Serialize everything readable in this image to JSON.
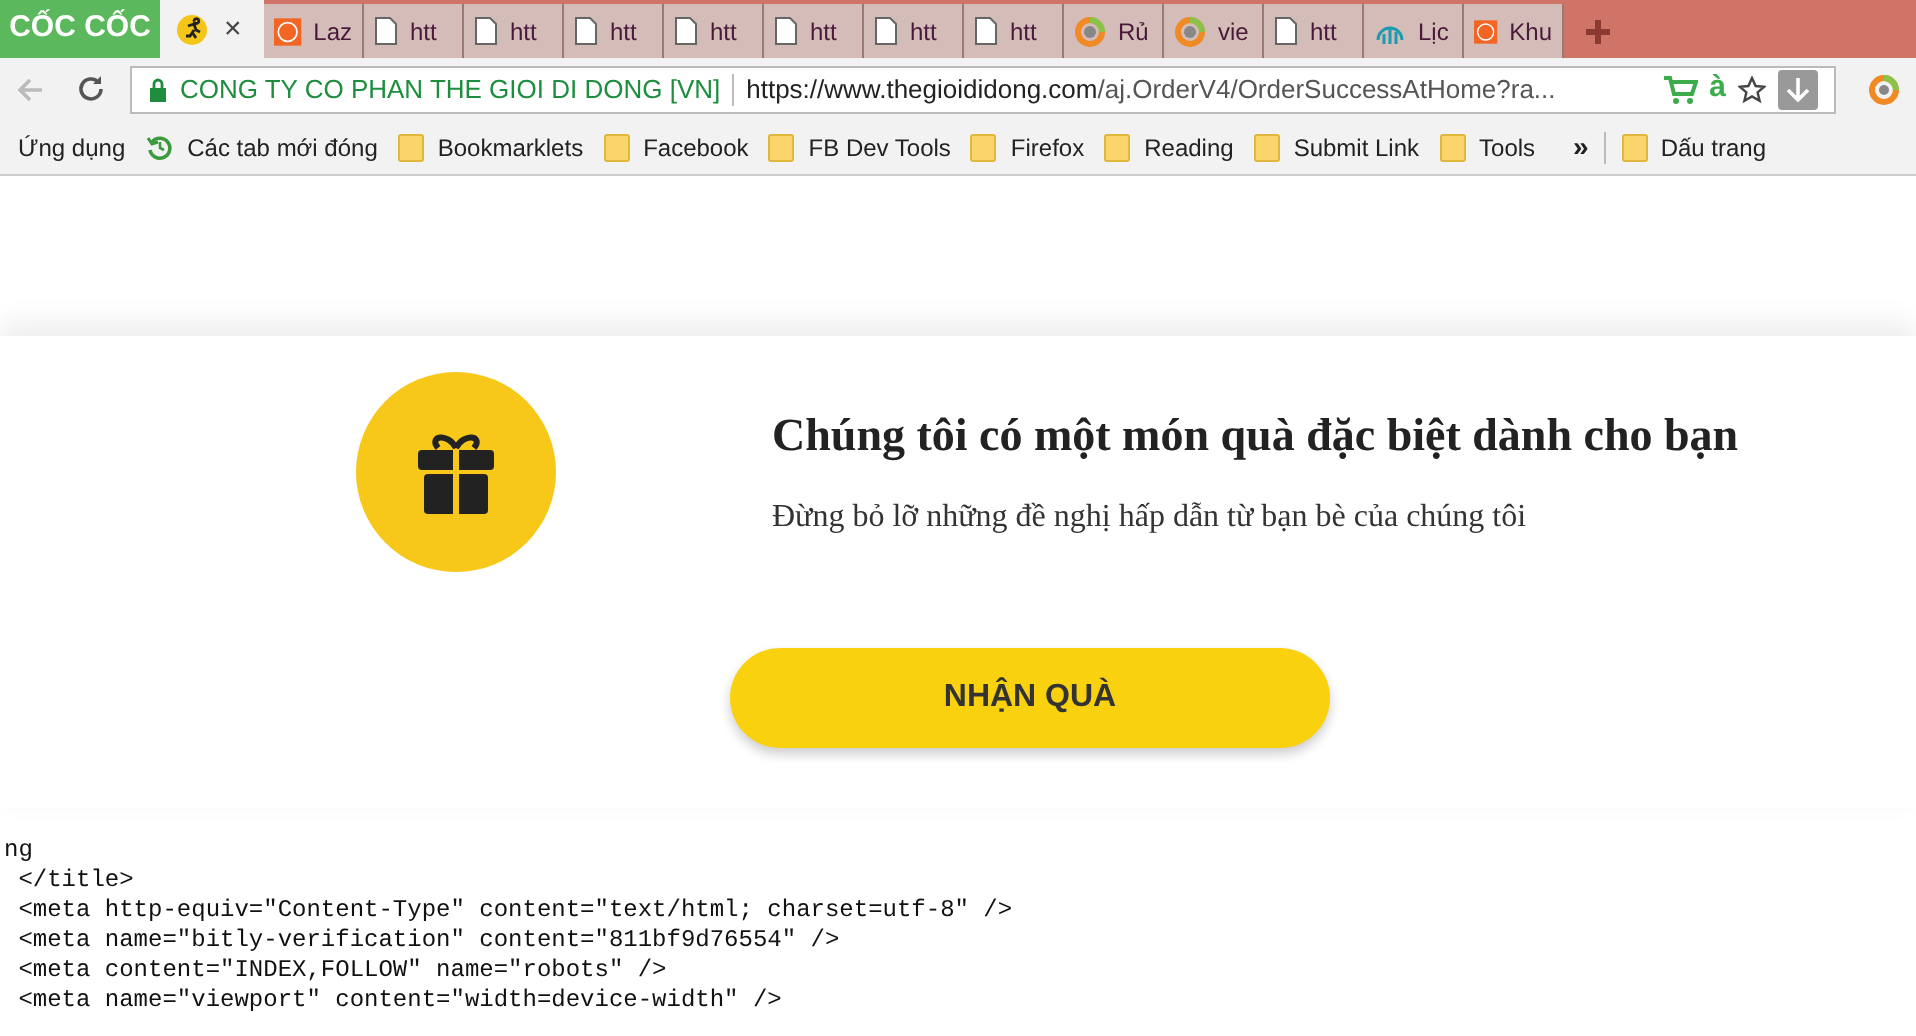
{
  "browser": {
    "logo": "CỐC CỐC",
    "tabs": [
      {
        "kind": "runner",
        "selected": true
      },
      {
        "title": "Laz",
        "kind": "orange",
        "selected": false
      },
      {
        "title": "htt",
        "kind": "page",
        "selected": false
      },
      {
        "title": "htt",
        "kind": "page",
        "selected": false
      },
      {
        "title": "htt",
        "kind": "page",
        "selected": false
      },
      {
        "title": "htt",
        "kind": "page",
        "selected": false
      },
      {
        "title": "htt",
        "kind": "page",
        "selected": false
      },
      {
        "title": "htt",
        "kind": "page",
        "selected": false
      },
      {
        "title": "htt",
        "kind": "page",
        "selected": false
      },
      {
        "title": "Rủ",
        "kind": "ring",
        "selected": false
      },
      {
        "title": "vie",
        "kind": "ring",
        "selected": false
      },
      {
        "title": "htt",
        "kind": "page",
        "selected": false
      },
      {
        "title": "Lịc",
        "kind": "chart",
        "selected": false
      },
      {
        "title": "Khu",
        "kind": "orange",
        "selected": false
      }
    ],
    "close": "×",
    "address": {
      "site": "CONG TY CO PHAN THE GIOI DI DONG [VN]",
      "host": "https://www.thegioididong.com",
      "path": "/aj.OrderV4/OrderSuccessAtHome?ra..."
    },
    "translate": "à",
    "bookmarks": [
      {
        "label": "Ứng dụng",
        "kind": "apps"
      },
      {
        "label": "Các tab mới đóng",
        "kind": "history"
      },
      {
        "label": "Bookmarklets",
        "kind": "folder"
      },
      {
        "label": "Facebook",
        "kind": "folder"
      },
      {
        "label": "FB Dev Tools",
        "kind": "folder"
      },
      {
        "label": "Firefox",
        "kind": "folder"
      },
      {
        "label": "Reading",
        "kind": "folder"
      },
      {
        "label": "Submit Link",
        "kind": "folder"
      },
      {
        "label": "Tools",
        "kind": "folder"
      }
    ],
    "more": "»",
    "other_bookmarks": "Dấu trang"
  },
  "popup": {
    "title": "Chúng tôi có một món quà đặc biệt dành cho bạn",
    "subtitle": "Đừng bỏ lỡ những đề nghị hấp dẫn từ bạn bè của chúng tôi",
    "button": "NHẬN QUÀ"
  },
  "source_lines": [
    "ng",
    " </title>",
    " <meta http-equiv=\"Content-Type\" content=\"text/html; charset=utf-8\" />",
    " <meta name=\"bitly-verification\" content=\"811bf9d76554\" />",
    " <meta content=\"INDEX,FOLLOW\" name=\"robots\" />",
    " <meta name=\"viewport\" content=\"width=device-width\" />"
  ]
}
